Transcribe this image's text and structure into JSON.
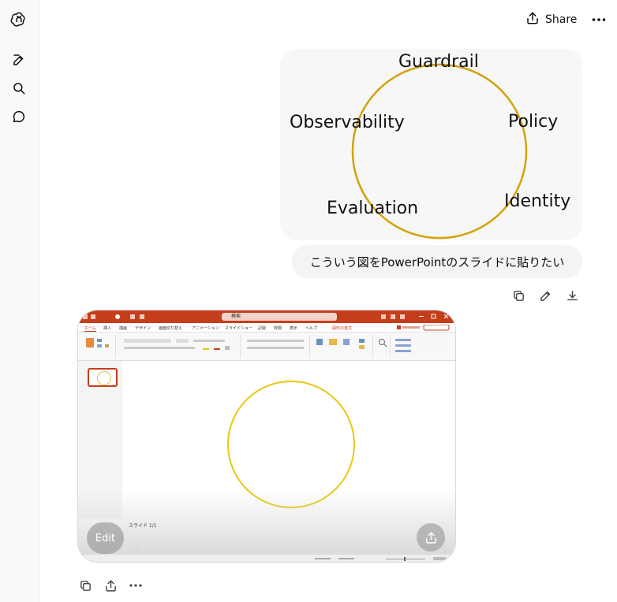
{
  "header": {
    "share_label": "Share"
  },
  "sidebar": {
    "icons": [
      "openai-logo-icon",
      "new-chat-icon",
      "search-icon",
      "chat-bubble-icon"
    ]
  },
  "diagram": {
    "labels": [
      "Guardrail",
      "Policy",
      "Identity",
      "Evaluation",
      "Observability"
    ],
    "circle_color": "#d4a20a"
  },
  "user_message": {
    "text": "こういう図をPowerPointのスライドに貼りたい"
  },
  "screenshot": {
    "search_text": "検索",
    "tabs": [
      "ホーム",
      "挿入",
      "描画",
      "デザイン",
      "画面切り替え",
      "アニメーション",
      "スライドショー",
      "記録",
      "校閲",
      "表示",
      "ヘルプ",
      "図形の書式"
    ],
    "slide_counter": "スライド 1/1",
    "circle_color": "#e8c812",
    "edit_label": "Edit"
  }
}
